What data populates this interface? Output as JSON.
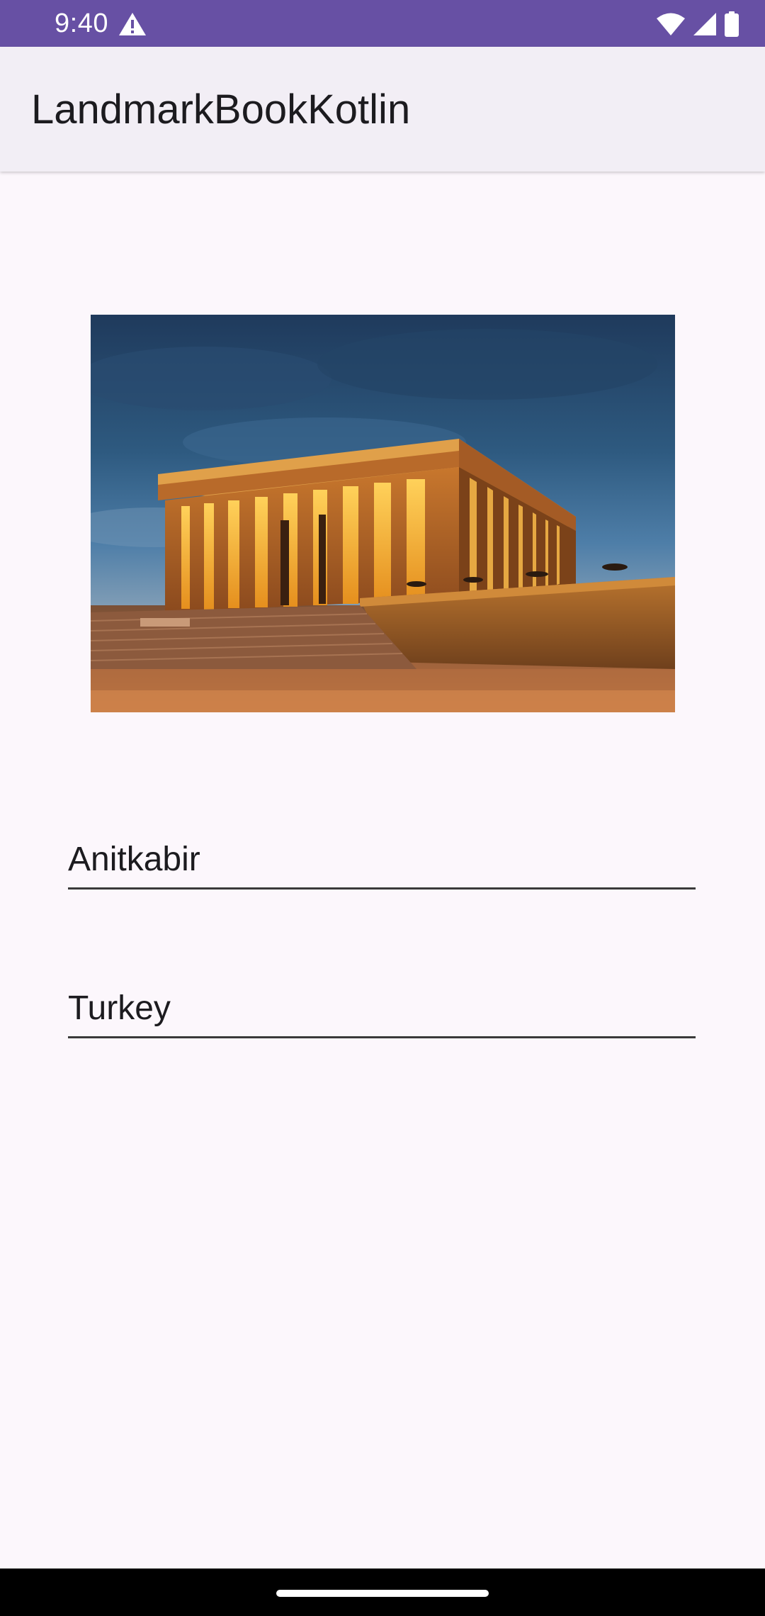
{
  "status_bar": {
    "time": "9:40",
    "icons": [
      "warning-icon",
      "wifi-icon",
      "cellular-signal-icon",
      "battery-icon"
    ],
    "background_color": "#6750A4"
  },
  "app_bar": {
    "title": "LandmarkBookKotlin",
    "background_color": "#F2EEF5"
  },
  "landmark": {
    "name": "Anitkabir",
    "country": "Turkey"
  },
  "colors": {
    "page_background": "#FCF7FC",
    "text": "#1C1B1F"
  }
}
